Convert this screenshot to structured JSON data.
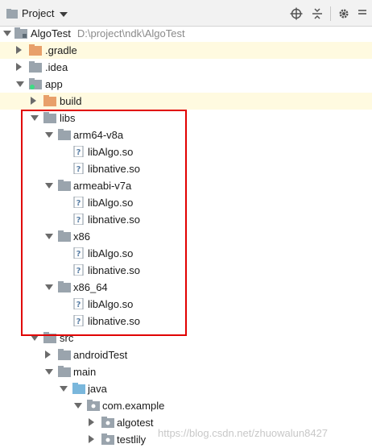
{
  "toolbar": {
    "title": "Project",
    "icons": [
      "crosshair-icon",
      "collapse-icon",
      "gear-icon",
      "hide-icon"
    ]
  },
  "tree": {
    "root": {
      "label": "AlgoTest",
      "path": "D:\\project\\ndk\\AlgoTest"
    },
    "gradle": ".gradle",
    "idea": ".idea",
    "app": "app",
    "build": "build",
    "libs": "libs",
    "abis": [
      {
        "name": "arm64-v8a",
        "files": [
          "libAlgo.so",
          "libnative.so"
        ]
      },
      {
        "name": "armeabi-v7a",
        "files": [
          "libAlgo.so",
          "libnative.so"
        ]
      },
      {
        "name": "x86",
        "files": [
          "libAlgo.so",
          "libnative.so"
        ]
      },
      {
        "name": "x86_64",
        "files": [
          "libAlgo.so",
          "libnative.so"
        ]
      }
    ],
    "src": "src",
    "androidTest": "androidTest",
    "main": "main",
    "java": "java",
    "package": "com.example",
    "algotest": "algotest",
    "testlily": "testlily"
  },
  "watermark": "https://blog.csdn.net/zhuowalun8427",
  "colors": {
    "folder_gray": "#9aa4ad",
    "folder_orange": "#e8a06a",
    "folder_blue": "#7ab7dc",
    "highlight_border": "#e10000",
    "selected_row": "#fffae0"
  }
}
